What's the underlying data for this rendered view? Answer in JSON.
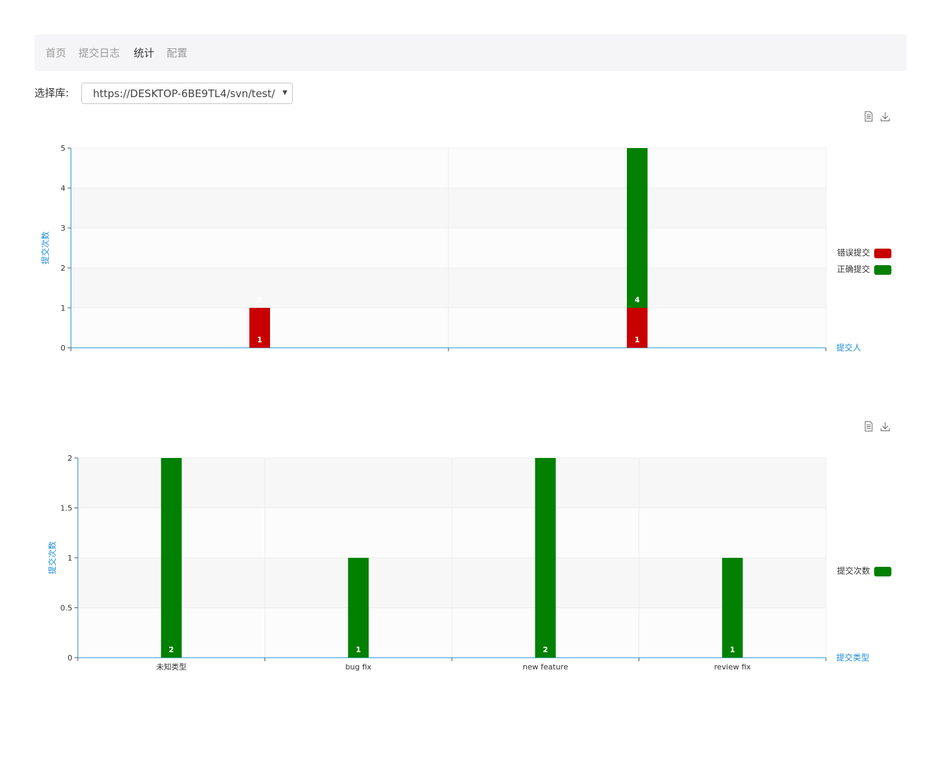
{
  "nav": {
    "items": [
      {
        "label": "首页",
        "active": false
      },
      {
        "label": "提交日志",
        "active": false
      },
      {
        "label": "统计",
        "active": true
      },
      {
        "label": "配置",
        "active": false
      }
    ]
  },
  "repo": {
    "label": "选择库:",
    "selected": "https://DESKTOP-6BE9TL4/svn/test/"
  },
  "toolbox": {
    "data_view": "data-view-icon",
    "save_image": "download-icon"
  },
  "colors": {
    "error": "#c80000",
    "correct": "#028002",
    "count": "#028002",
    "axis": "#1f8fd8"
  },
  "chart_data": [
    {
      "type": "bar",
      "stacked": true,
      "categories": [
        "",
        ""
      ],
      "series": [
        {
          "name": "错误提交",
          "values": [
            1,
            1
          ],
          "color": "#c80000",
          "labels": [
            "1",
            "1"
          ]
        },
        {
          "name": "正确提交",
          "values": [
            0,
            4
          ],
          "color": "#028002",
          "labels": [
            "0",
            "4"
          ]
        }
      ],
      "xlabel": "提交人",
      "ylabel": "提交次数",
      "ylim": [
        0,
        5
      ],
      "yticks": [
        "0",
        "1",
        "2",
        "3",
        "4",
        "5"
      ],
      "grid": true,
      "legend": "right"
    },
    {
      "type": "bar",
      "stacked": false,
      "categories": [
        "未知类型",
        "bug fix",
        "new feature",
        "review fix"
      ],
      "series": [
        {
          "name": "提交次数",
          "values": [
            2,
            1,
            2,
            1
          ],
          "color": "#028002",
          "labels": [
            "2",
            "1",
            "2",
            "1"
          ]
        }
      ],
      "xlabel": "提交类型",
      "ylabel": "提交次数",
      "ylim": [
        0,
        2
      ],
      "yticks": [
        "0",
        "0.5",
        "1",
        "1.5",
        "2"
      ],
      "grid": true,
      "legend": "right"
    }
  ]
}
